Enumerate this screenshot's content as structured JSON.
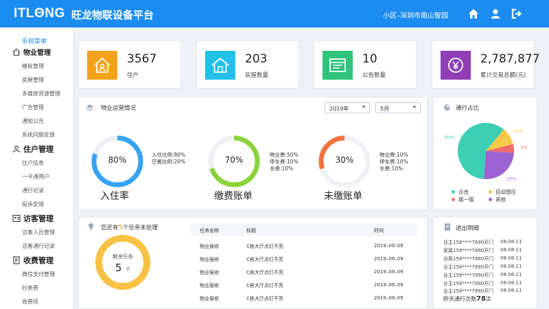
{
  "header": {
    "logo": "ITLΘNG",
    "title": "旺龙物联设备平台",
    "location": "小区–深圳市南山智园"
  },
  "sidebar": {
    "menu_label": "系统菜单",
    "groups": [
      {
        "label": "物业管理",
        "items": [
          "楼栋管理",
          "房屋管理",
          "多媒体资源管理",
          "广告管理",
          "通知公告",
          "系统问题反馈"
        ]
      },
      {
        "label": "住户管理",
        "items": [
          "住户信息",
          "一卡通用户",
          "通行记录",
          "投诉反馈"
        ]
      },
      {
        "label": "访客管理",
        "items": [
          "访客人员管理",
          "访客通行记录"
        ]
      },
      {
        "label": "收费管理",
        "items": [
          "微信支付管理",
          "抄表费",
          "收费项"
        ]
      }
    ]
  },
  "stats": [
    {
      "value": "3567",
      "label": "住户",
      "color": "#f5a21b"
    },
    {
      "value": "203",
      "label": "房屋数量",
      "color": "#22c0e8"
    },
    {
      "value": "10",
      "label": "公告数量",
      "color": "#2fc47a"
    },
    {
      "value": "2,787,877",
      "label": "累计交易总额(元)",
      "color": "#8d3fb3"
    }
  ],
  "ops": {
    "title": "物业运营情况",
    "year": "2019年",
    "month": "5月",
    "gauges": [
      {
        "pct": "80%",
        "fraction": 0.8,
        "name": "入住率",
        "color": "#36a3f7",
        "details": [
          "入住比例:80%",
          "空置比例:20%"
        ]
      },
      {
        "pct": "70%",
        "fraction": 0.7,
        "name": "缴费账单",
        "color": "#8bd33a",
        "details": [
          "物业费:50%",
          "停车费:10%",
          "水费:10%"
        ]
      },
      {
        "pct": "30%",
        "fraction": 0.3,
        "name": "未缴账单",
        "color": "#f27340",
        "details": [
          "物业费:10%",
          "停车费:10%",
          "水费:10%"
        ]
      }
    ]
  },
  "traffic": {
    "title": "通行占比",
    "slices": [
      {
        "name": "点击",
        "value": 60,
        "label": "60%",
        "color": "#3dcfb4"
      },
      {
        "name": "自动感应",
        "value": 10,
        "label": "10%",
        "color": "#f6c94a"
      },
      {
        "name": "摇一摇",
        "value": 5,
        "label": "5%",
        "color": "#ef6a6a"
      },
      {
        "name": "其他",
        "value": 25,
        "label": "25%",
        "color": "#9c63d2"
      }
    ]
  },
  "tasks": {
    "prefix": "您还有",
    "count": "5",
    "suffix": "个任务未处理",
    "donut_label": "剩余任务",
    "donut_value": "5",
    "donut_unit": "个",
    "headers": [
      "任务名称",
      "标题",
      "时间"
    ],
    "rows": [
      [
        "物业报修",
        "C栋大厅点灯不亮",
        "2019–09–09"
      ],
      [
        "物业报修",
        "C栋大厅点灯不亮",
        "2019–09–09"
      ],
      [
        "物业报修",
        "C栋大厅点灯不亮",
        "2019–09–09"
      ],
      [
        "物业报修",
        "C栋大厅点灯不亮",
        "2019–09–09"
      ],
      [
        "物业报修",
        "C栋大厅点灯不亮",
        "2019–09–09"
      ]
    ]
  },
  "access": {
    "title": "进出明细",
    "rows": [
      [
        "业主158****7890开门",
        "08:08:11"
      ],
      [
        "家属158****7890开门",
        "08:08:11"
      ],
      [
        "访客158****7890开门",
        "08:08:11"
      ],
      [
        "业主158****7890开门",
        "08:08:11"
      ],
      [
        "业主158****7890开门",
        "08:08:11"
      ],
      [
        "业主158****7890开门",
        "08:08:11"
      ],
      [
        "业主158****7890开门",
        "08:08:11"
      ]
    ],
    "summary_label": "昨天通行次数",
    "summary_value": "78",
    "summary_unit": "次"
  }
}
